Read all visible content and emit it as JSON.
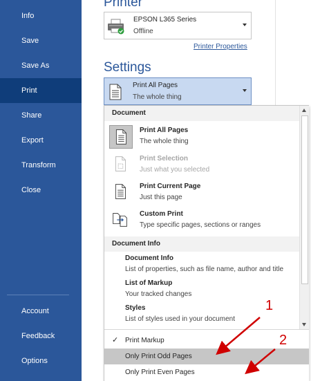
{
  "sidebar": {
    "items": [
      {
        "label": "Info"
      },
      {
        "label": "Save"
      },
      {
        "label": "Save As"
      },
      {
        "label": "Print",
        "active": true
      },
      {
        "label": "Share"
      },
      {
        "label": "Export"
      },
      {
        "label": "Transform"
      },
      {
        "label": "Close"
      }
    ],
    "bottom_items": [
      {
        "label": "Account"
      },
      {
        "label": "Feedback"
      },
      {
        "label": "Options"
      }
    ],
    "bg_color": "#2b579a",
    "active_color": "#0f3d7a"
  },
  "printer": {
    "section_title": "Printer",
    "name": "EPSON L365 Series",
    "status": "Offline",
    "properties_link": "Printer Properties",
    "icon": "printer-icon"
  },
  "settings": {
    "section_title": "Settings",
    "selected_title": "Print All Pages",
    "selected_desc": "The whole thing"
  },
  "dropdown": {
    "document_header": "Document",
    "options": [
      {
        "title": "Print All Pages",
        "desc": "The whole thing",
        "selected": true,
        "disabled": false,
        "icon": "all-pages-icon"
      },
      {
        "title": "Print Selection",
        "desc": "Just what you selected",
        "selected": false,
        "disabled": true,
        "icon": "selection-icon"
      },
      {
        "title": "Print Current Page",
        "desc": "Just this page",
        "selected": false,
        "disabled": false,
        "icon": "current-page-icon"
      },
      {
        "title": "Custom Print",
        "desc": "Type specific pages, sections or ranges",
        "selected": false,
        "disabled": false,
        "icon": "custom-print-icon"
      }
    ],
    "info_header": "Document Info",
    "info_items": [
      {
        "title": "Document Info",
        "desc": "List of properties, such as file name, author and title"
      },
      {
        "title": "List of Markup",
        "desc": "Your tracked changes"
      },
      {
        "title": "Styles",
        "desc": "List of styles used in your document"
      }
    ],
    "bottom_items": [
      {
        "label": "Print Markup",
        "checked": true
      },
      {
        "label": "Only Print Odd Pages",
        "highlighted": true
      },
      {
        "label": "Only Print Even Pages"
      }
    ]
  },
  "annotations": {
    "label1": "1",
    "label2": "2",
    "color": "#d00000"
  }
}
